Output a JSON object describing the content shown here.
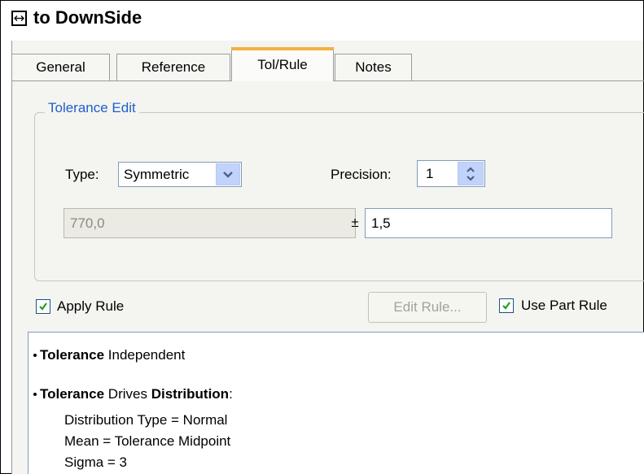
{
  "window": {
    "title": "to DownSide",
    "title_icon": "horizontal-dimension-icon"
  },
  "tabs": [
    {
      "label": "General",
      "active": false
    },
    {
      "label": "Reference",
      "active": false
    },
    {
      "label": "Tol/Rule",
      "active": true
    },
    {
      "label": "Notes",
      "active": false
    }
  ],
  "tolerance_edit": {
    "group_label": "Tolerance Edit",
    "type_label": "Type:",
    "type_value": "Symmetric",
    "precision_label": "Precision:",
    "precision_value": "1",
    "nominal_value": "770,0",
    "plus_minus": "±",
    "tolerance_value": "1,5"
  },
  "rule": {
    "apply_rule_label": "Apply Rule",
    "apply_rule_checked": true,
    "edit_rule_label": "Edit Rule...",
    "use_part_rule_label": "Use Part Rule",
    "use_part_rule_checked": true
  },
  "description": {
    "line1_bold": "Tolerance",
    "line1_rest": " Independent",
    "line2_bold1": "Tolerance",
    "line2_mid": " Drives ",
    "line2_bold2": "Distribution",
    "line2_end": ":",
    "line3": "Distribution Type = Normal",
    "line4": "Mean = Tolerance Midpoint",
    "line5": "Sigma = 3"
  },
  "colors": {
    "accent": "#f3b140",
    "group_label": "#1f5fcf",
    "check": "#21a121",
    "field_border": "#7f9db9"
  }
}
